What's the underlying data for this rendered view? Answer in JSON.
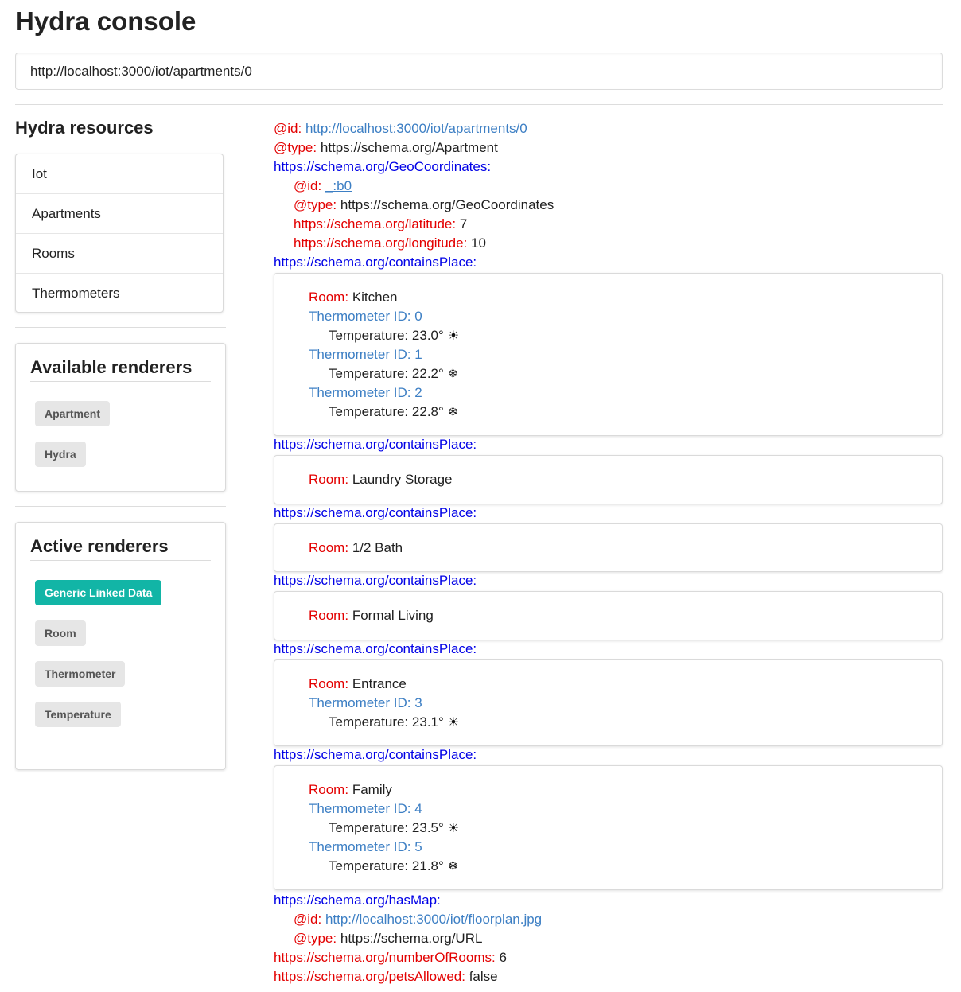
{
  "app": {
    "title": "Hydra console"
  },
  "address_bar": {
    "value": "http://localhost:3000/iot/apartments/0"
  },
  "sidebar": {
    "resources_title": "Hydra resources",
    "resources": [
      {
        "label": "Iot"
      },
      {
        "label": "Apartments"
      },
      {
        "label": "Rooms"
      },
      {
        "label": "Thermometers"
      }
    ],
    "available_title": "Available renderers",
    "available": [
      {
        "label": "Apartment"
      },
      {
        "label": "Hydra"
      }
    ],
    "active_title": "Active renderers",
    "active": [
      {
        "label": "Generic Linked Data",
        "active": true
      },
      {
        "label": "Room",
        "active": false
      },
      {
        "label": "Thermometer",
        "active": false
      },
      {
        "label": "Temperature",
        "active": false
      }
    ]
  },
  "resource": {
    "id_key": "@id:",
    "id_value": "http://localhost:3000/iot/apartments/0",
    "type_key": "@type:",
    "type_value": "https://schema.org/Apartment",
    "geo_key": "https://schema.org/GeoCoordinates:",
    "geo": {
      "id_key": "@id:",
      "id_value": "_:b0",
      "type_key": "@type:",
      "type_value": "https://schema.org/GeoCoordinates",
      "lat_key": "https://schema.org/latitude:",
      "lat_value": "7",
      "lon_key": "https://schema.org/longitude:",
      "lon_value": "10"
    },
    "contains_key": "https://schema.org/containsPlace:",
    "room_key": "Room:",
    "thermo_prefix": "Thermometer ID:",
    "temp_prefix": "Temperature:",
    "rooms": [
      {
        "name": "Kitchen",
        "thermometers": [
          {
            "id": "0",
            "temp": "23.0°",
            "icon": "sun-icon"
          },
          {
            "id": "1",
            "temp": "22.2°",
            "icon": "snowflake-icon"
          },
          {
            "id": "2",
            "temp": "22.8°",
            "icon": "snowflake-icon"
          }
        ]
      },
      {
        "name": "Laundry Storage",
        "thermometers": []
      },
      {
        "name": "1/2 Bath",
        "thermometers": []
      },
      {
        "name": "Formal Living",
        "thermometers": []
      },
      {
        "name": "Entrance",
        "thermometers": [
          {
            "id": "3",
            "temp": "23.1°",
            "icon": "sun-icon"
          }
        ]
      },
      {
        "name": "Family",
        "thermometers": [
          {
            "id": "4",
            "temp": "23.5°",
            "icon": "sun-icon"
          },
          {
            "id": "5",
            "temp": "21.8°",
            "icon": "snowflake-icon"
          }
        ]
      }
    ],
    "map_key": "https://schema.org/hasMap:",
    "map": {
      "id_key": "@id:",
      "id_value": "http://localhost:3000/iot/floorplan.jpg",
      "type_key": "@type:",
      "type_value": "https://schema.org/URL"
    },
    "rooms_count_key": "https://schema.org/numberOfRooms:",
    "rooms_count_value": "6",
    "pets_key": "https://schema.org/petsAllowed:",
    "pets_value": "false"
  },
  "icons": {
    "sun": "☀",
    "snowflake": "❄"
  },
  "colors": {
    "accent": "#12b5a6",
    "key_red": "#e30000",
    "key_blue": "#0000e6",
    "link": "#3d7fc4"
  }
}
